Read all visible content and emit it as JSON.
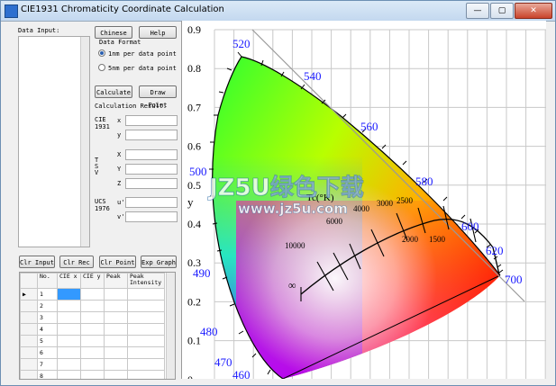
{
  "window": {
    "title": "CIE1931 Chromaticity Coordinate Calculation",
    "minimize": "—",
    "maximize": "▢",
    "close": "✕"
  },
  "left": {
    "data_input_label": "Data Input:",
    "chinese_button": "Chinese",
    "help_button": "Help",
    "data_format_label": "Data Format",
    "format_options": [
      "1nm per data point",
      "5nm per data point"
    ],
    "selected_format": 0,
    "calculate_button": "Calculate",
    "draw_point_button": "Draw Point",
    "calc_result_label": "Calculation Result:",
    "cie_group_label": "CIE\n1931",
    "x_label": "x",
    "y_label": "y",
    "tristim_group_label": "T\nS\nV",
    "X_label": "X",
    "Y_label": "Y",
    "Z_label": "Z",
    "ucs_group_label": "UCS\n1976",
    "u_label": "u'",
    "v_label": "v'",
    "clr_input_button": "Clr Input",
    "clr_rec_button": "Clr Rec",
    "clr_point_button": "Clr Point",
    "exp_graph_button": "Exp Graph"
  },
  "table": {
    "headers": [
      "No.",
      "CIE x",
      "CIE y",
      "Peak",
      "Peak Intensity"
    ],
    "rows": [
      "1",
      "2",
      "3",
      "4",
      "5",
      "6",
      "7",
      "8"
    ]
  },
  "chart": {
    "y_axis_label": "y",
    "y_ticks": [
      "0.9",
      "0.8",
      "0.7",
      "0.6",
      "0.5",
      "0.4",
      "0.3",
      "0.2",
      "0.1",
      "0"
    ],
    "wavelength_labels": [
      "520",
      "540",
      "560",
      "580",
      "600",
      "620",
      "700",
      "500",
      "490",
      "480",
      "470",
      "460"
    ],
    "planck_title": "Tc(°K)",
    "temp_labels": [
      "10000",
      "6000",
      "4000",
      "3000",
      "2500",
      "2000",
      "1500",
      "∞"
    ],
    "watermark": "JZ5U绿色下载",
    "watermark_url": "www.jz5u.com"
  }
}
